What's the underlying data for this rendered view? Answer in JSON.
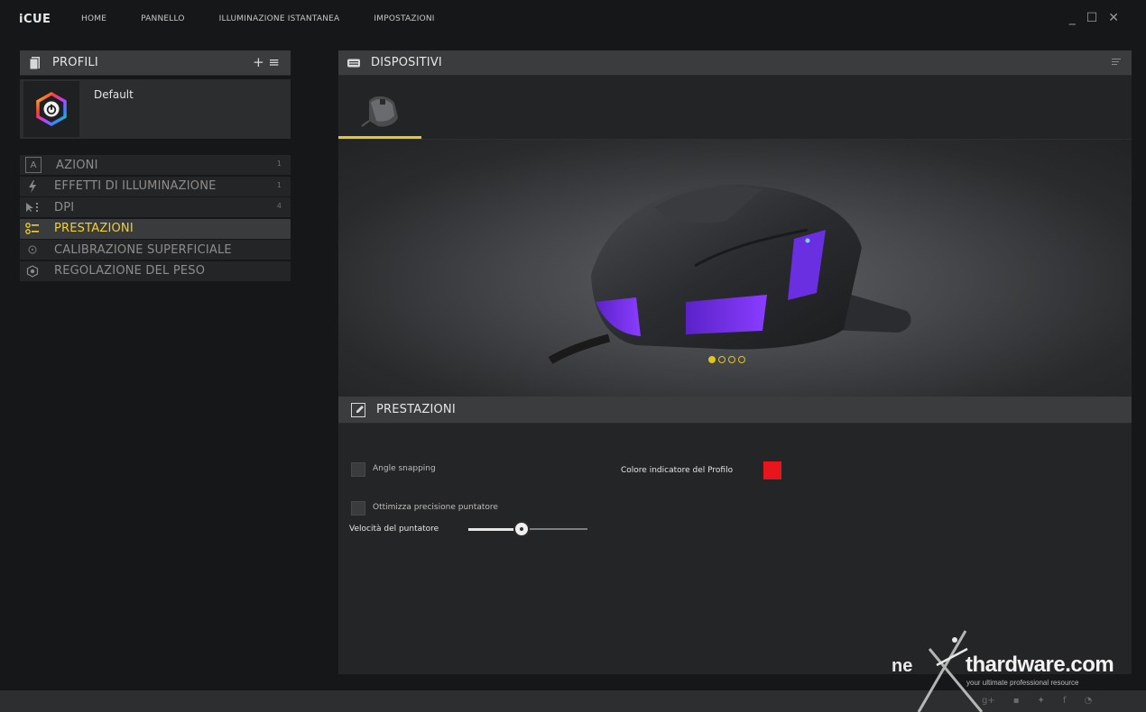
{
  "app": {
    "logo": "iCUE"
  },
  "topnav": [
    "HOME",
    "PANNELLO",
    "ILLUMINAZIONE ISTANTANEA",
    "IMPOSTAZIONI"
  ],
  "window_controls": {
    "minimize": "_",
    "maximize": "☐",
    "close": "✕"
  },
  "profiles": {
    "title": "PROFILI",
    "add": "+",
    "menu": "≡",
    "items": [
      {
        "name": "Default"
      }
    ]
  },
  "menu": [
    {
      "label": "AZIONI",
      "count": "1",
      "icon": "letter-a-icon"
    },
    {
      "label": "EFFETTI DI ILLUMINAZIONE",
      "count": "1",
      "icon": "lightning-icon"
    },
    {
      "label": "DPI",
      "count": "4",
      "icon": "cursor-dpi-icon"
    },
    {
      "label": "PRESTAZIONI",
      "count": "",
      "icon": "performance-icon",
      "active": true
    },
    {
      "label": "CALIBRAZIONE SUPERFICIALE",
      "count": "",
      "icon": "calibration-icon"
    },
    {
      "label": "REGOLAZIONE DEL PESO",
      "count": "",
      "icon": "weight-icon"
    }
  ],
  "devices": {
    "title": "DISPOSITIVI",
    "carousel_dots": 4,
    "active_dot": 0
  },
  "prestazioni": {
    "title": "PRESTAZIONI",
    "angle_snapping": {
      "label": "Angle snapping",
      "checked": false
    },
    "precision": {
      "label": "Ottimizza precisione puntatore",
      "checked": false
    },
    "color_indicator": {
      "label": "Colore indicatore del Profilo",
      "color": "#e8151d"
    },
    "speed": {
      "label": "Velocità del puntatore",
      "value_fraction": 0.45
    }
  },
  "colors": {
    "accent": "#e8c81a",
    "active_text": "#f2d22a"
  },
  "watermark": {
    "ne": "ne",
    "brand": "thardware.com",
    "tagline": "your ultimate professional resource"
  }
}
